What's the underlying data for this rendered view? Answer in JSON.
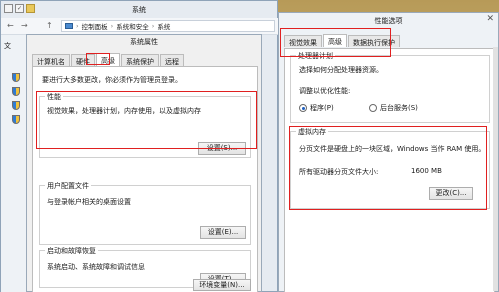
{
  "system_window": {
    "title": "系统",
    "nav": {
      "back": "←",
      "forward": "→",
      "up": "↑"
    },
    "breadcrumb": [
      "控制面板",
      "系统和安全",
      "系统"
    ],
    "breadcrumb_sep": "›",
    "left_panel_char": "文"
  },
  "system_properties": {
    "title": "系统属性",
    "tabs": [
      "计算机名",
      "硬件",
      "高级",
      "系统保护",
      "远程"
    ],
    "active_tab": "高级",
    "intro": "要进行大多数更改，你必须作为管理员登录。",
    "performance": {
      "label": "性能",
      "description": "视觉效果，处理器计划，内存使用，以及虚拟内存",
      "button": "设置(S)..."
    },
    "user_profiles": {
      "label": "用户配置文件",
      "description": "与登录帐户相关的桌面设置",
      "button": "设置(E)..."
    },
    "startup_recovery": {
      "label": "启动和故障恢复",
      "description": "系统启动、系统故障和调试信息",
      "button": "设置(T)..."
    },
    "env_button": "环境变量(N)..."
  },
  "performance_options": {
    "title": "性能选项",
    "close_glyph": "✕",
    "tabs": [
      "视觉效果",
      "高级",
      "数据执行保护"
    ],
    "active_tab": "高级",
    "processor_scheduling": {
      "label": "处理器计划",
      "description": "选择如何分配处理器资源。",
      "optimize_label": "调整以优化性能:",
      "options": [
        "程序(P)",
        "后台服务(S)"
      ],
      "selected": "程序(P)"
    },
    "virtual_memory": {
      "label": "虚拟内存",
      "description": "分页文件是硬盘上的一块区域，Windows 当作 RAM 使用。",
      "total_label": "所有驱动器分页文件大小:",
      "total_value": "1600 MB",
      "change_button": "更改(C)..."
    }
  },
  "highlight_color": "#e02020"
}
